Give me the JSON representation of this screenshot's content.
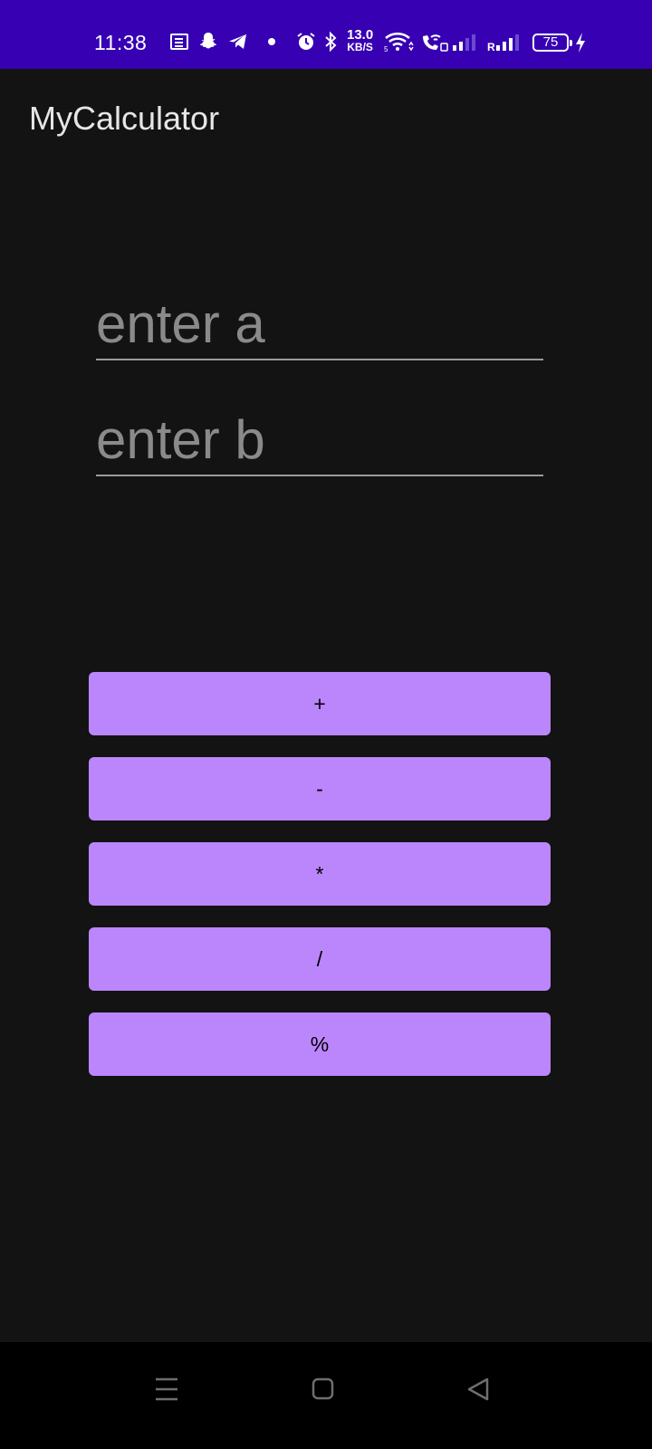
{
  "status_bar": {
    "time": "11:38",
    "speed_value": "13.0",
    "speed_unit": "KB/S",
    "battery": "75",
    "bg_color": "#3700b3"
  },
  "app": {
    "title": "MyCalculator"
  },
  "inputs": {
    "a": {
      "placeholder": "enter a",
      "value": ""
    },
    "b": {
      "placeholder": "enter b",
      "value": ""
    }
  },
  "buttons": {
    "add": "+",
    "subtract": "-",
    "multiply": "*",
    "divide": "/",
    "modulo": "%",
    "color": "#bb86fc"
  },
  "nav": {
    "icons": [
      "menu-icon",
      "home-icon",
      "back-icon"
    ]
  }
}
